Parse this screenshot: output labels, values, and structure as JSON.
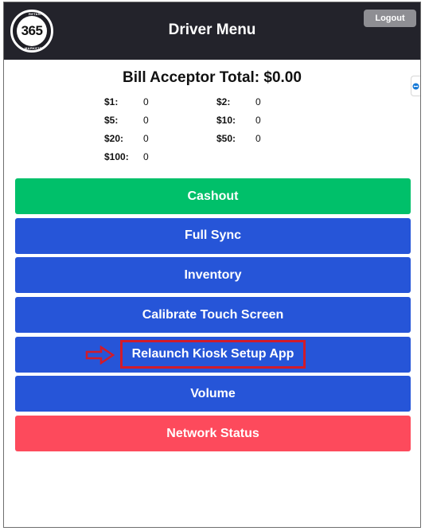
{
  "header": {
    "logo_text": "365",
    "logo_top_text": "RETAIL",
    "logo_bottom_text": "MARKETS",
    "title": "Driver Menu",
    "logout_label": "Logout"
  },
  "summary": {
    "title": "Bill Acceptor Total: $0.00",
    "denominations": [
      {
        "label": "$1:",
        "value": "0"
      },
      {
        "label": "$2:",
        "value": "0"
      },
      {
        "label": "$5:",
        "value": "0"
      },
      {
        "label": "$10:",
        "value": "0"
      },
      {
        "label": "$20:",
        "value": "0"
      },
      {
        "label": "$50:",
        "value": "0"
      },
      {
        "label": "$100:",
        "value": "0"
      }
    ]
  },
  "buttons": {
    "cashout": "Cashout",
    "full_sync": "Full Sync",
    "inventory": "Inventory",
    "calibrate": "Calibrate Touch Screen",
    "relaunch": "Relaunch Kiosk Setup App",
    "volume": "Volume",
    "network": "Network Status"
  },
  "colors": {
    "header_bg": "#23232b",
    "green": "#00c06a",
    "blue": "#2655d8",
    "red": "#fd4a5c",
    "highlight": "#d11b2b"
  },
  "icons": {
    "side_tab": "teamviewer-icon",
    "annotation": "arrow-right-icon"
  }
}
